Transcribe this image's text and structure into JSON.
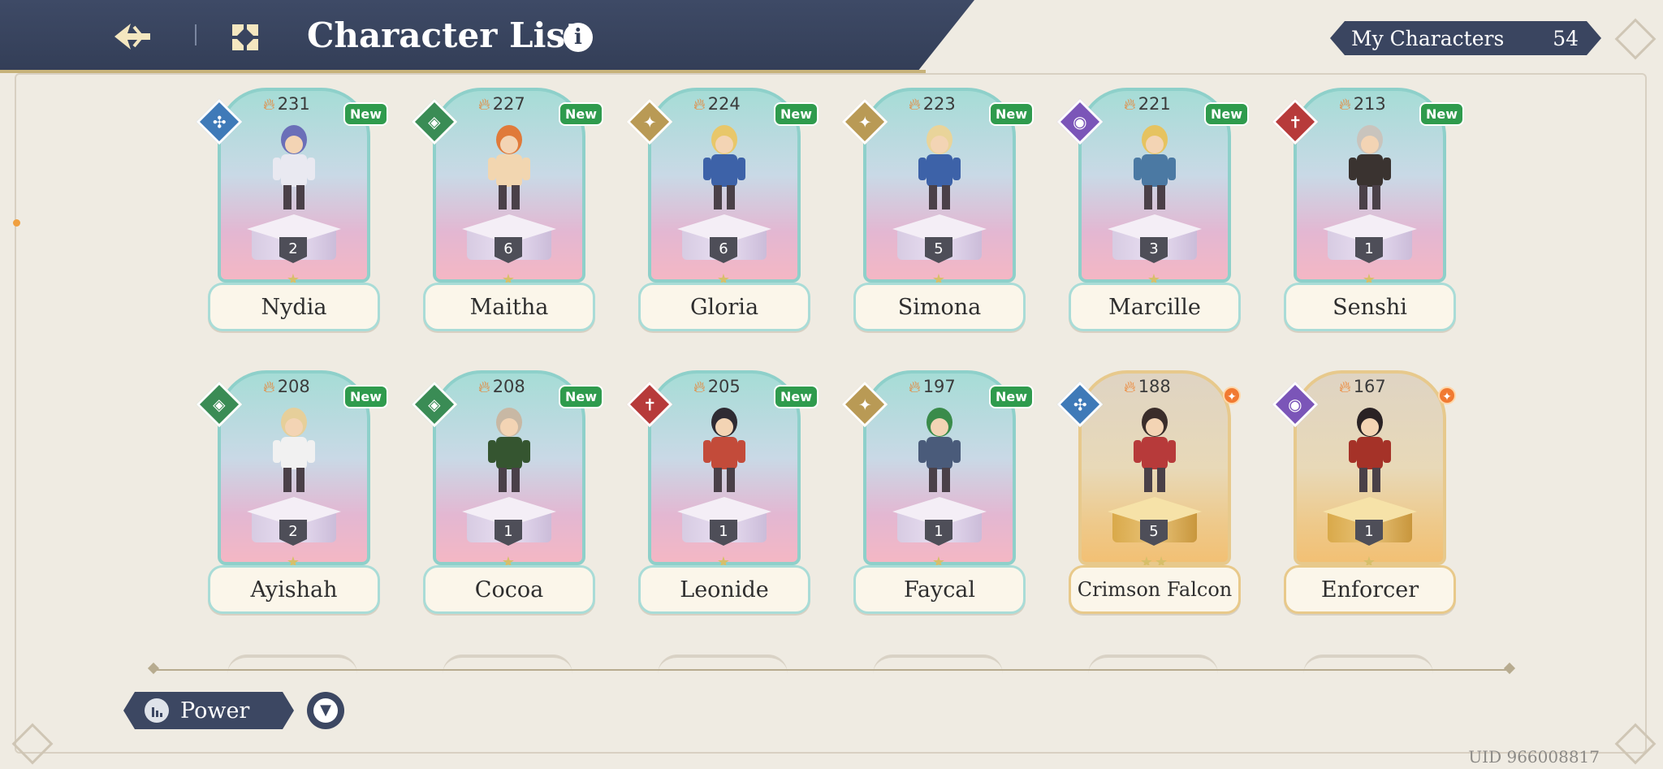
{
  "header": {
    "title": "Character List",
    "info_label": "i"
  },
  "my_characters": {
    "label": "My Characters",
    "count": "54"
  },
  "sort": {
    "label": "Power"
  },
  "uid": "UID 966008817",
  "colors": {
    "header_bg": "#333e57",
    "new_badge": "#2f9b4d",
    "flame": "#ef7a22",
    "wind": "#3f7ab8",
    "earth": "#3a8c55",
    "light": "#b99a55",
    "dark": "#7b55b8",
    "fire": "#b73a3a"
  },
  "characters": [
    {
      "name": "Nydia",
      "power": "231",
      "level": "2",
      "stars": "★",
      "element": "wind",
      "badge": "New",
      "variant": "normal",
      "icon": "wind-element-icon"
    },
    {
      "name": "Maitha",
      "power": "227",
      "level": "6",
      "stars": "★",
      "element": "earth",
      "badge": "New",
      "variant": "normal",
      "icon": "earth-element-icon"
    },
    {
      "name": "Gloria",
      "power": "224",
      "level": "6",
      "stars": "★",
      "element": "light",
      "badge": "New",
      "variant": "normal",
      "icon": "light-element-icon"
    },
    {
      "name": "Simona",
      "power": "223",
      "level": "5",
      "stars": "★",
      "element": "light",
      "badge": "New",
      "variant": "normal",
      "icon": "light-element-icon"
    },
    {
      "name": "Marcille",
      "power": "221",
      "level": "3",
      "stars": "★",
      "element": "dark",
      "badge": "New",
      "variant": "normal",
      "icon": "dark-element-icon"
    },
    {
      "name": "Senshi",
      "power": "213",
      "level": "1",
      "stars": "★",
      "element": "fire",
      "badge": "New",
      "variant": "normal",
      "icon": "fire-element-icon"
    },
    {
      "name": "Ayishah",
      "power": "208",
      "level": "2",
      "stars": "★",
      "element": "earth",
      "badge": "New",
      "variant": "normal",
      "icon": "earth-element-icon"
    },
    {
      "name": "Cocoa",
      "power": "208",
      "level": "1",
      "stars": "★",
      "element": "earth",
      "badge": "New",
      "variant": "normal",
      "icon": "earth-element-icon"
    },
    {
      "name": "Leonide",
      "power": "205",
      "level": "1",
      "stars": "★",
      "element": "fire",
      "badge": "New",
      "variant": "normal",
      "icon": "fire-element-icon"
    },
    {
      "name": "Faycal",
      "power": "197",
      "level": "1",
      "stars": "★",
      "element": "light",
      "badge": "New",
      "variant": "normal",
      "icon": "light-element-icon"
    },
    {
      "name": "Crimson Falcon",
      "power": "188",
      "level": "5",
      "stars": "★★",
      "element": "wind",
      "badge": "",
      "variant": "gold",
      "icon": "wind-element-icon"
    },
    {
      "name": "Enforcer",
      "power": "167",
      "level": "1",
      "stars": "★",
      "element": "dark",
      "badge": "",
      "variant": "gold",
      "icon": "dark-element-icon"
    }
  ]
}
